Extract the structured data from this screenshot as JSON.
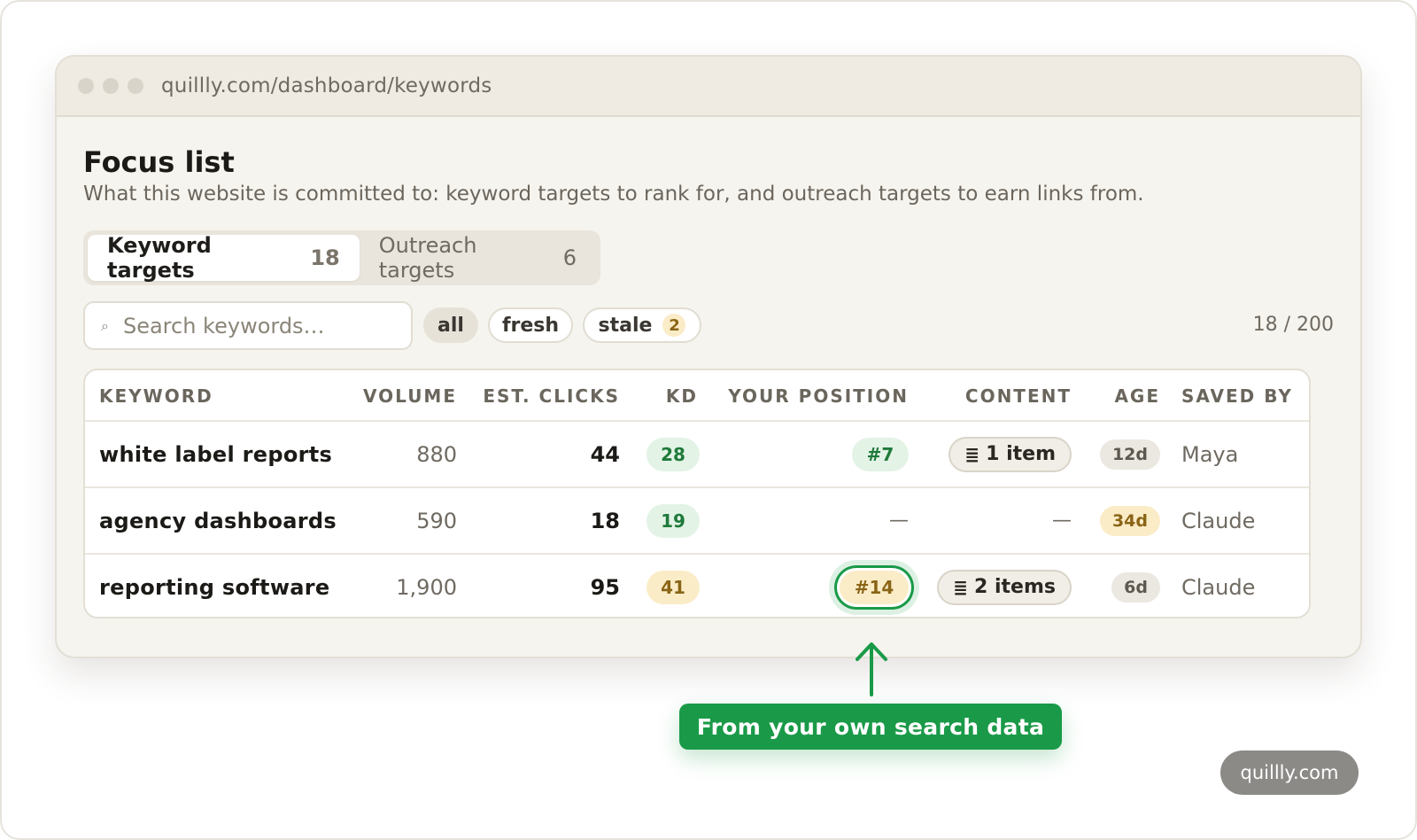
{
  "browser": {
    "url": "quillly.com/dashboard/keywords"
  },
  "page": {
    "title": "Focus list",
    "subtitle": "What this website is committed to: keyword targets to rank for, and outreach targets to earn links from."
  },
  "tabs": [
    {
      "label": "Keyword targets",
      "count": "18",
      "active": true
    },
    {
      "label": "Outreach targets",
      "count": "6",
      "active": false
    }
  ],
  "search": {
    "placeholder": "Search keywords…",
    "value": ""
  },
  "filters": {
    "all": "all",
    "fresh": "fresh",
    "stale": "stale",
    "stale_count": "2"
  },
  "quota": "18 / 200",
  "table": {
    "headers": {
      "keyword": "KEYWORD",
      "volume": "VOLUME",
      "clicks": "EST. CLICKS",
      "kd": "KD",
      "position": "YOUR POSITION",
      "content": "CONTENT",
      "age": "AGE",
      "saved_by": "SAVED BY"
    },
    "rows": [
      {
        "keyword": "white label reports",
        "volume": "880",
        "clicks": "44",
        "kd": "28",
        "position": "#7",
        "content": "1 item",
        "age": "12d",
        "saved_by": "Maya"
      },
      {
        "keyword": "agency dashboards",
        "volume": "590",
        "clicks": "18",
        "kd": "19",
        "position": "—",
        "content": "—",
        "age": "34d",
        "saved_by": "Claude"
      },
      {
        "keyword": "reporting software",
        "volume": "1,900",
        "clicks": "95",
        "kd": "41",
        "position": "#14",
        "content": "2 items",
        "age": "6d",
        "saved_by": "Claude"
      }
    ]
  },
  "callout": "From your own search data",
  "watermark": "quillly.com",
  "colors": {
    "accent_green": "#1a9a48",
    "amber": "#fbecc8",
    "background": "#f6f4ee"
  },
  "icons": {
    "search": "search-icon",
    "list": "list-icon",
    "arrow": "arrow-up-icon"
  }
}
